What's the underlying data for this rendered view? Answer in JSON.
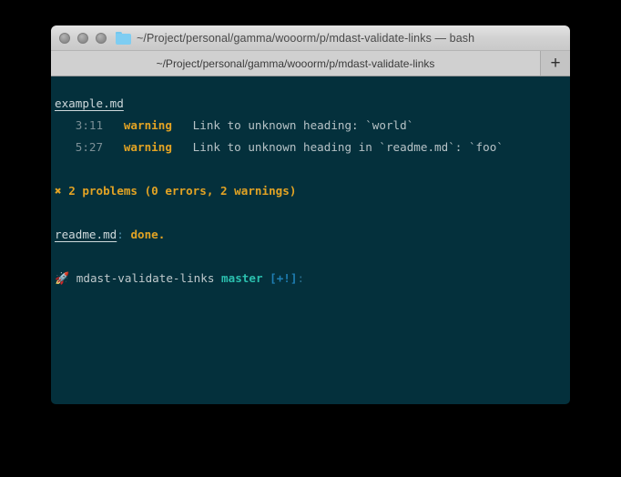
{
  "window": {
    "title": "~/Project/personal/gamma/wooorm/p/mdast-validate-links — bash",
    "folder_icon": "folder-icon",
    "traffic_lights": [
      "close",
      "minimize",
      "zoom"
    ],
    "background_color": "#04303c"
  },
  "tabbar": {
    "active_tab_label": "~/Project/personal/gamma/wooorm/p/mdast-validate-links",
    "new_tab_label": "+"
  },
  "terminal": {
    "file_heading": "example.md",
    "messages": [
      {
        "position": "3:11",
        "severity": "warning",
        "text": "Link to unknown heading: `world`"
      },
      {
        "position": "5:27",
        "severity": "warning",
        "text": "Link to unknown heading in `readme.md`: `foo`"
      }
    ],
    "summary_icon": "✖",
    "summary": "2 problems (0 errors, 2 warnings)",
    "done_file": "readme.md",
    "done_colon": ":",
    "done_status": "done.",
    "prompt": {
      "emoji": "🚀",
      "directory": "mdast-validate-links",
      "branch": "master",
      "flags": "[+!]",
      "colon": ":"
    },
    "colors": {
      "background": "#04303c",
      "warning": "#e2a324",
      "text": "#b6c2c6",
      "position": "#7b8f96",
      "branch": "#2bbfae",
      "flags": "#1f7fb5"
    }
  }
}
